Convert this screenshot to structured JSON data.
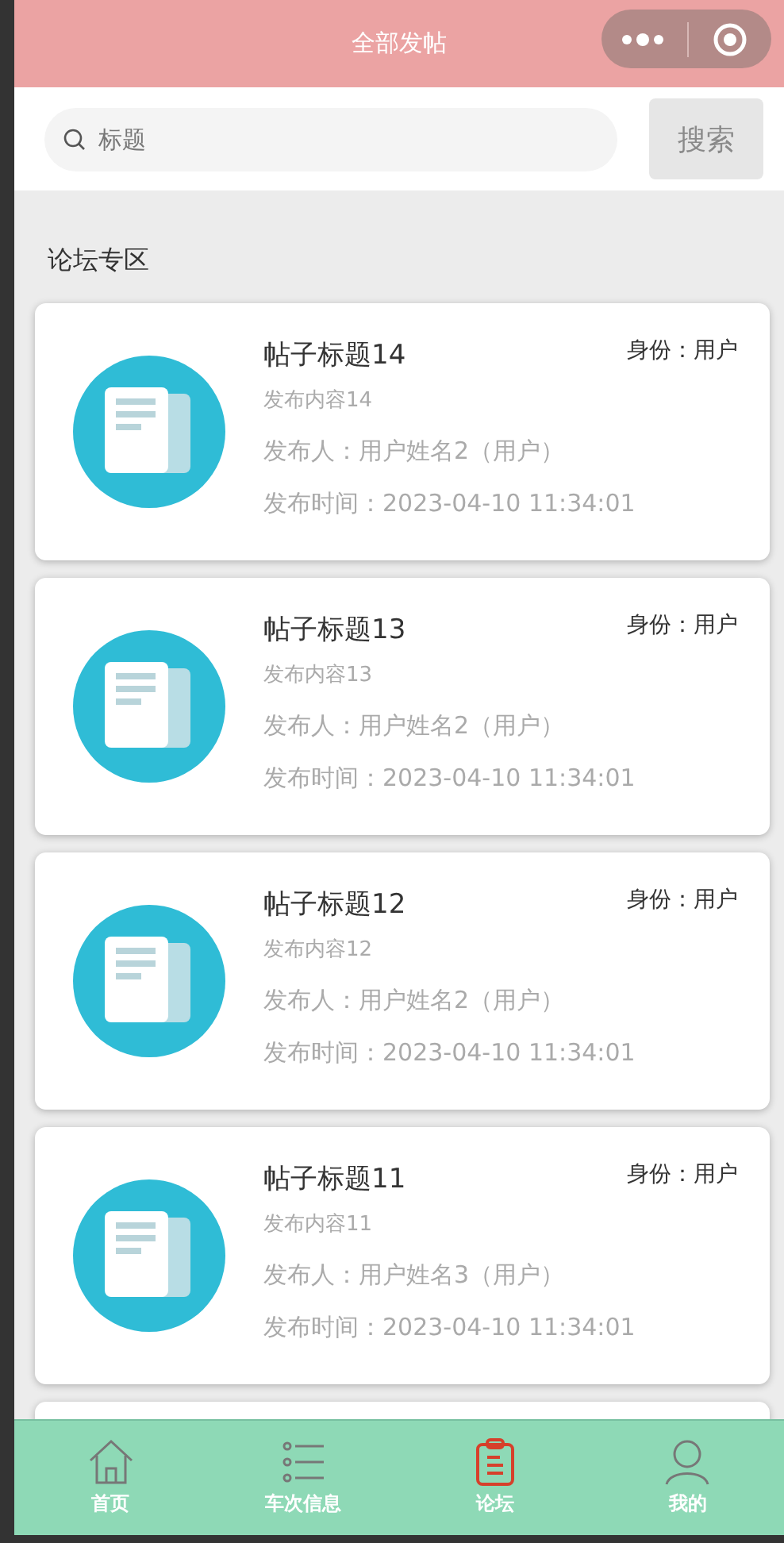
{
  "header": {
    "title": "全部发帖"
  },
  "search": {
    "placeholder": "标题",
    "button": "搜索"
  },
  "section_title": "论坛专区",
  "posts": [
    {
      "title": "帖子标题14",
      "role": "身份：用户",
      "content": "发布内容14",
      "author": "发布人：用户姓名2（用户）",
      "time": "发布时间：2023-04-10 11:34:01"
    },
    {
      "title": "帖子标题13",
      "role": "身份：用户",
      "content": "发布内容13",
      "author": "发布人：用户姓名2（用户）",
      "time": "发布时间：2023-04-10 11:34:01"
    },
    {
      "title": "帖子标题12",
      "role": "身份：用户",
      "content": "发布内容12",
      "author": "发布人：用户姓名2（用户）",
      "time": "发布时间：2023-04-10 11:34:01"
    },
    {
      "title": "帖子标题11",
      "role": "身份：用户",
      "content": "发布内容11",
      "author": "发布人：用户姓名3（用户）",
      "time": "发布时间：2023-04-10 11:34:01"
    }
  ],
  "more_posts_below": true,
  "tabs": [
    {
      "label": "首页",
      "kind": "home",
      "selected": false
    },
    {
      "label": "车次信息",
      "kind": "list",
      "selected": false
    },
    {
      "label": "论坛",
      "kind": "forum",
      "selected": true
    },
    {
      "label": "我的",
      "kind": "user",
      "selected": false
    }
  ]
}
